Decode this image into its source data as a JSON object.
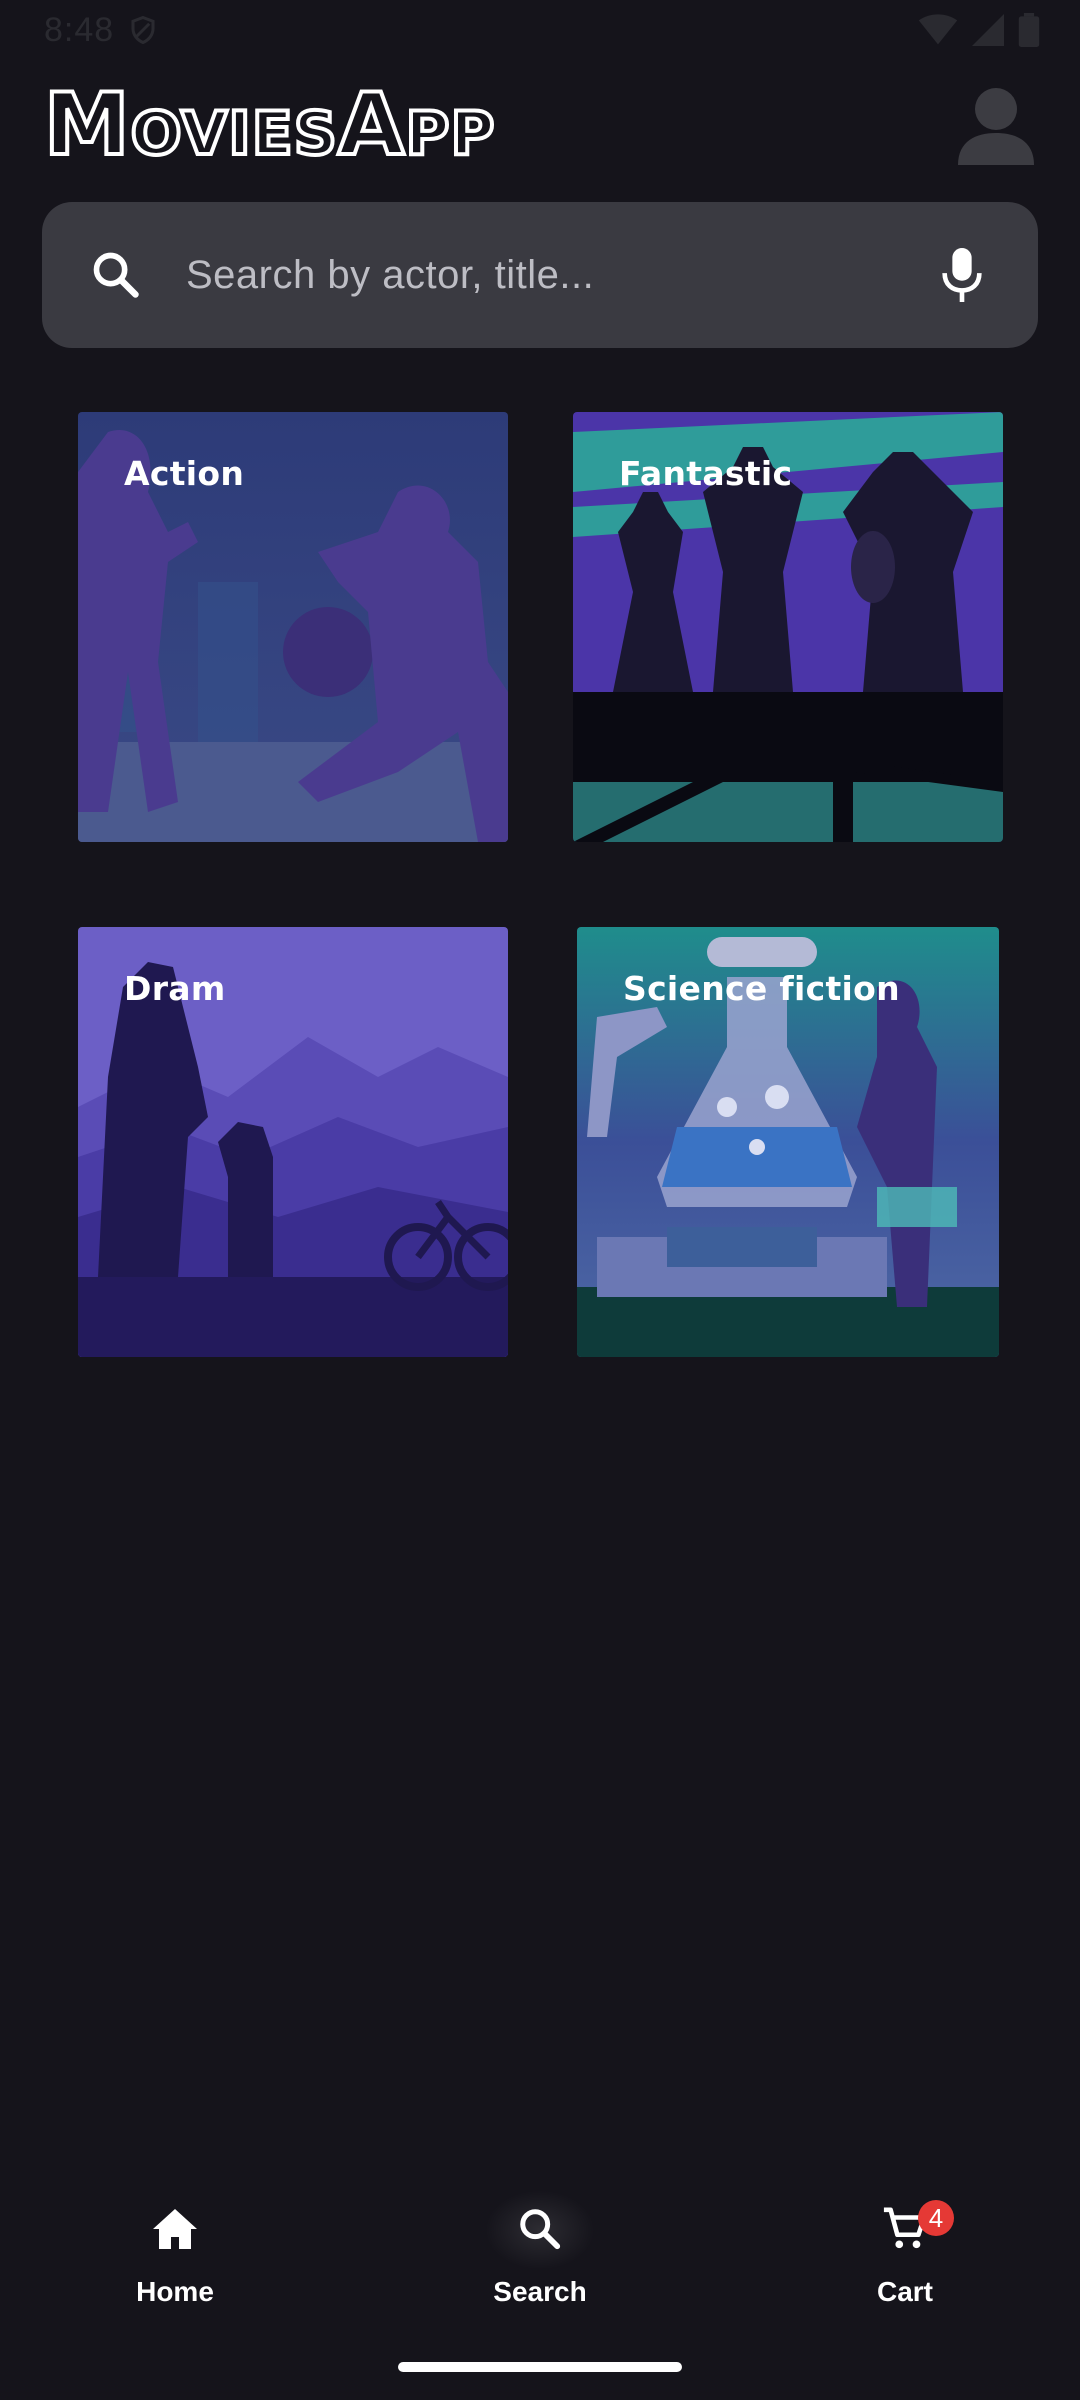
{
  "status_bar": {
    "time": "8:48"
  },
  "header": {
    "logo": "MoviesApp"
  },
  "search": {
    "placeholder": "Search by actor, title..."
  },
  "categories": [
    {
      "label": "Action"
    },
    {
      "label": "Fantastic"
    },
    {
      "label": "Dram"
    },
    {
      "label": "Science fiction"
    }
  ],
  "nav": {
    "home_label": "Home",
    "search_label": "Search",
    "cart_label": "Cart",
    "cart_badge": "4"
  },
  "colors": {
    "background": "#15141b",
    "search_bg": "#3a3a41",
    "badge": "#e53935"
  }
}
